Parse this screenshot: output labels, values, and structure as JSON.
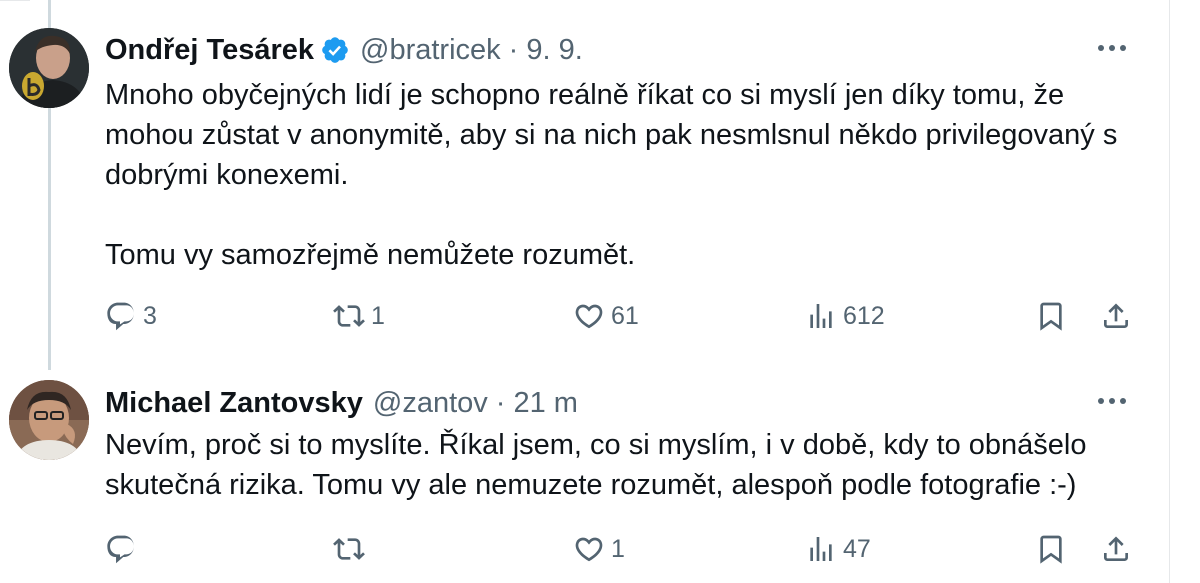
{
  "tweets": [
    {
      "author": {
        "name": "Ondřej Tesárek",
        "handle": "@bratricek",
        "verified": true,
        "avatar_icon": "avatar-photo"
      },
      "separator": "·",
      "timestamp": "9. 9.",
      "paragraphs": [
        "Mnoho obyčejných lidí je schopno reálně říkat co si myslí jen díky tomu, že mohou zůstat v anonymitě, aby si na nich pak nesmlsnul někdo privilegovaný s dobrými konexemi.",
        "Tomu vy samozřejmě nemůžete rozumět."
      ],
      "stats": {
        "replies": "3",
        "reposts": "1",
        "likes": "61",
        "views": "612"
      }
    },
    {
      "author": {
        "name": "Michael Zantovsky",
        "handle": "@zantov",
        "verified": false,
        "avatar_icon": "avatar-photo"
      },
      "separator": "·",
      "timestamp": "21 m",
      "paragraphs": [
        "Nevím, proč si to myslíte. Říkal jsem, co si myslím, i v době, kdy to obnášelo skutečná rizika. Tomu vy ale nemuzete rozumět, alespoň podle fotografie :-)"
      ],
      "stats": {
        "replies": "",
        "reposts": "",
        "likes": "1",
        "views": "47"
      }
    }
  ],
  "colors": {
    "text": "#0f1419",
    "secondary": "#536471",
    "verified": "#1d9bf0",
    "thread_line": "#cfd9de"
  },
  "icons": [
    "verified-badge-icon",
    "more-icon",
    "reply-icon",
    "repost-icon",
    "like-icon",
    "views-icon",
    "bookmark-icon",
    "share-icon"
  ]
}
